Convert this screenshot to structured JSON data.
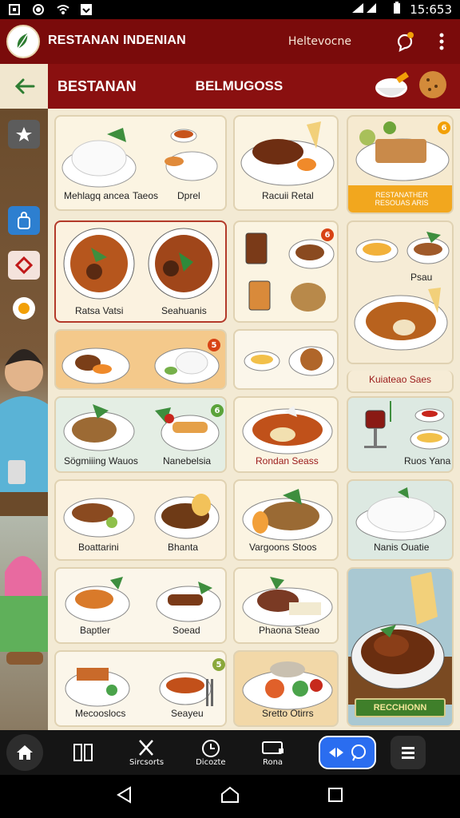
{
  "status": {
    "time": "15:653"
  },
  "app": {
    "brand": "RESTANAN INDENIAN",
    "brand_sub": "",
    "welcome": "Heltevocne"
  },
  "header": {
    "title": "BESTANAN",
    "center_title": "BELMUGOSS"
  },
  "menu": {
    "col1": [
      {
        "left": "Mehlagq ancea",
        "right": "Taeos",
        "extra": "Dprel"
      },
      {
        "left": "Ratsa Vatsi",
        "right": "Seahuanis"
      },
      {
        "left": "",
        "right": ""
      },
      {
        "left": "Sögmiiing Wauos",
        "right": "Nanebelsia"
      },
      {
        "left": "Boattarini",
        "right": "Bhanta"
      },
      {
        "left": "Baptler",
        "right": "Soead"
      },
      {
        "left": "Mecooslocs",
        "right": "Seayeu"
      }
    ],
    "col2": [
      "Racuii Retal",
      "",
      "",
      "Rondan Seass",
      "Vargoons Stoos",
      "Phaona Steao",
      "Sretto Otirrs"
    ],
    "col3": [
      "RESTANATHER RESOUAS ARIS",
      "Psau",
      "Kuiateao Saes",
      "Ruos Yana",
      "Nanis Ouatie",
      "RECCHIONN"
    ]
  },
  "nav": {
    "item2": "Sircsorts",
    "item3": "Dicozte",
    "item4": "Rona"
  },
  "colors": {
    "brand_red": "#7a0b0b",
    "accent_blue": "#2a6df0",
    "bg_cream": "#f3ead4"
  }
}
